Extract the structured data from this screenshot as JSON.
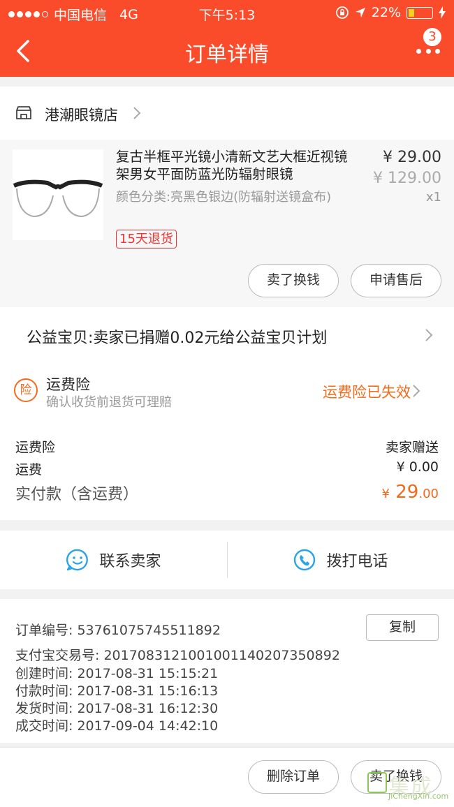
{
  "status_bar": {
    "carrier": "中国电信",
    "network": "4G",
    "time": "下午5:13",
    "battery": "22%"
  },
  "nav": {
    "title": "订单详情",
    "badge_count": "3"
  },
  "shop": {
    "name": "港潮眼镜店"
  },
  "product": {
    "name": "复古半框平光镜小清新文艺大框近视镜架男女平面防蓝光防辐射眼镜",
    "spec": "颜色分类:亮黑色银边(防辐射送镜盒布)",
    "refund_tag": "15天退货",
    "price": "¥ 29.00",
    "original_price": "¥ 129.00",
    "quantity": "x1",
    "actions": [
      "卖了换钱",
      "申请售后"
    ]
  },
  "charity": {
    "text": "公益宝贝:卖家已捐赠0.02元给公益宝贝计划"
  },
  "insurance": {
    "icon_text": "险",
    "title": "运费险",
    "subtitle": "确认收货前退货可理赔",
    "status": "运费险已失效"
  },
  "fees": {
    "rows": [
      {
        "label": "运费险",
        "value": "卖家赠送"
      },
      {
        "label": "运费",
        "value": "¥ 0.00"
      }
    ],
    "total_label": "实付款（含运费）",
    "total_symbol": "¥",
    "total_int": "29",
    "total_dec": ".00"
  },
  "contact": {
    "seller": "联系卖家",
    "phone": "拨打电话"
  },
  "order_info": {
    "order_no": "订单编号:   53761075745511892",
    "copy": "复制",
    "alipay_no": "支付宝交易号:   2017083121001001140207350892",
    "created": "创建时间:   2017-08-31 15:15:21",
    "paid": "付款时间:   2017-08-31 15:16:13",
    "shipped": "发货时间:   2017-08-31 16:12:30",
    "completed": "成交时间:   2017-09-04 14:42:10"
  },
  "footer": {
    "actions": [
      "删除订单",
      "卖了换钱"
    ]
  },
  "watermark": {
    "main": "集成信",
    "url": "JiChengXin.com"
  },
  "colors": {
    "brand": "#fa4b2a",
    "accent": "#f26b1d",
    "link_blue": "#2aa3e8"
  }
}
